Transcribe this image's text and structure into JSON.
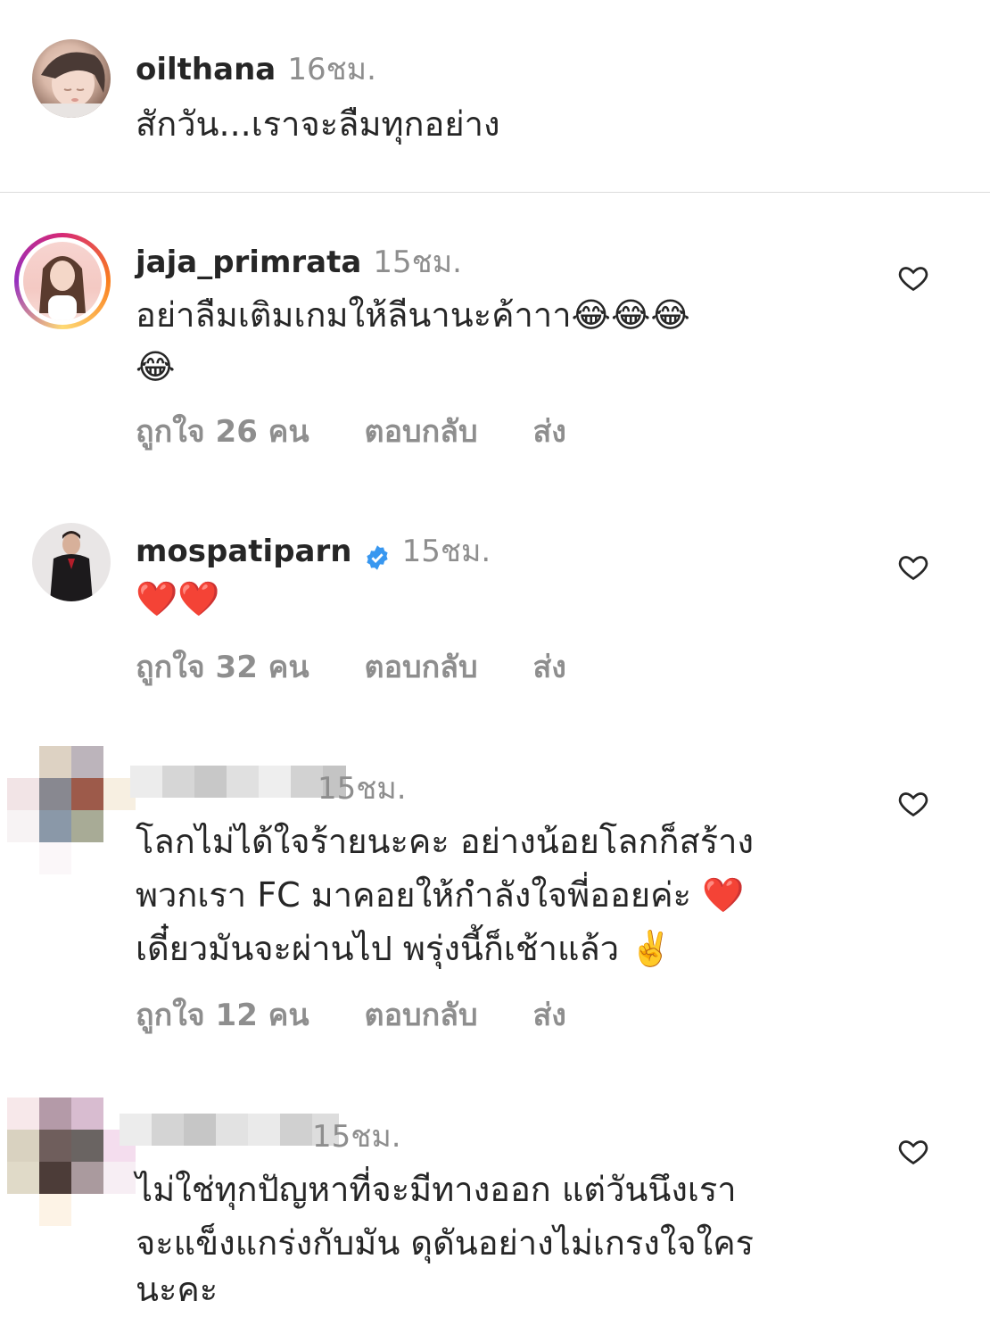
{
  "comments": [
    {
      "username": "oilthana",
      "time": "16ชม.",
      "text": "สักวัน...เราจะลืมทุกอย่าง"
    },
    {
      "username": "jaja_primrata",
      "time": "15ชม.",
      "text_line1": "อย่าลืมเติมเกมให้ลีนานะค้าาา😂😂😂",
      "text_line2": "😂",
      "likes": "ถูกใจ 26 คน",
      "reply": "ตอบกลับ",
      "send": "ส่ง"
    },
    {
      "username": "mospatiparn",
      "verified": true,
      "time": "15ชม.",
      "text": "❤️❤️",
      "likes": "ถูกใจ 32 คน",
      "reply": "ตอบกลับ",
      "send": "ส่ง"
    },
    {
      "username_hidden": true,
      "time": "15ชม.",
      "text_line1": "โลกไม่ได้ใจร้ายนะคะ อย่างน้อยโลกก็สร้าง",
      "text_line2": "พวกเรา FC มาคอยให้กำลังใจพี่ออยค่ะ ❤️",
      "text_line3": "เดี๋ยวมันจะผ่านไป  พรุ่งนี้ก็เช้าแล้ว ✌️",
      "likes": "ถูกใจ 12 คน",
      "reply": "ตอบกลับ",
      "send": "ส่ง"
    },
    {
      "username_hidden": true,
      "time": "15ชม.",
      "text_line1": "ไม่ใช่ทุกปัญหาที่จะมีทางออก แต่วันนึงเรา",
      "text_line2": "จะแข็งแกร่งกับมัน ดุดันอย่างไม่เกรงใจใคร",
      "text_line3": "นะคะ"
    }
  ],
  "icons": {
    "like": "heart-outline-icon",
    "verified": "verified-badge-icon"
  }
}
